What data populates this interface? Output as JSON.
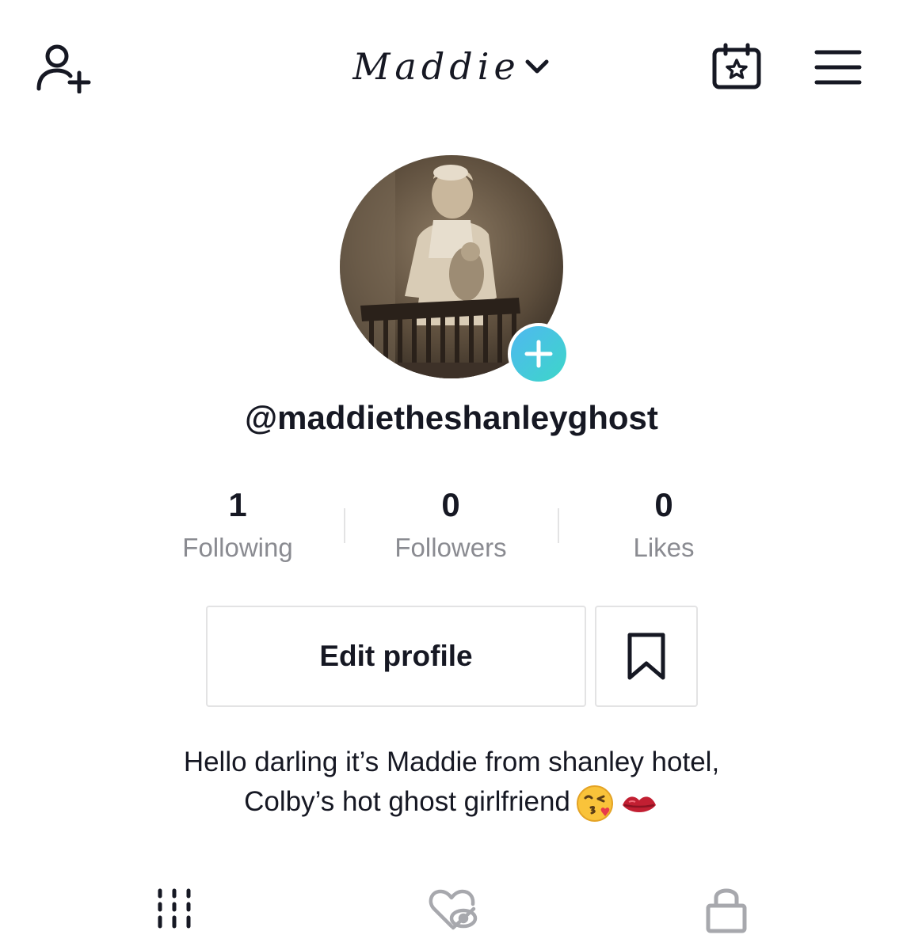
{
  "header": {
    "title": "Maddie",
    "icons": {
      "add_friend": "add-user-icon",
      "title_dropdown": "chevron-down-icon",
      "calendar": "calendar-star-icon",
      "menu": "hamburger-menu-icon"
    }
  },
  "profile": {
    "avatar": "vintage-sepia-child-photo",
    "avatar_add_icon": "plus-icon",
    "username": "@maddietheshanleyghost"
  },
  "stats": [
    {
      "value": "1",
      "label": "Following"
    },
    {
      "value": "0",
      "label": "Followers"
    },
    {
      "value": "0",
      "label": "Likes"
    }
  ],
  "actions": {
    "edit_profile_label": "Edit profile",
    "bookmark_icon": "bookmark-icon"
  },
  "bio": {
    "line1": "Hello darling it’s Maddie from shanley hotel,",
    "line2": "Colby’s hot ghost girlfriend",
    "emojis": [
      "kissing-face-wink-emoji",
      "kiss-lips-emoji"
    ]
  },
  "tabs": [
    {
      "icon": "grid-videos-icon"
    },
    {
      "icon": "liked-hidden-icon"
    },
    {
      "icon": "lock-icon"
    }
  ],
  "colors": {
    "text": "#161823",
    "secondary_text": "#8a8b91",
    "border": "#e3e3e4",
    "accent_gradient_start": "#4fb8f0",
    "accent_gradient_end": "#3dd6c9"
  }
}
